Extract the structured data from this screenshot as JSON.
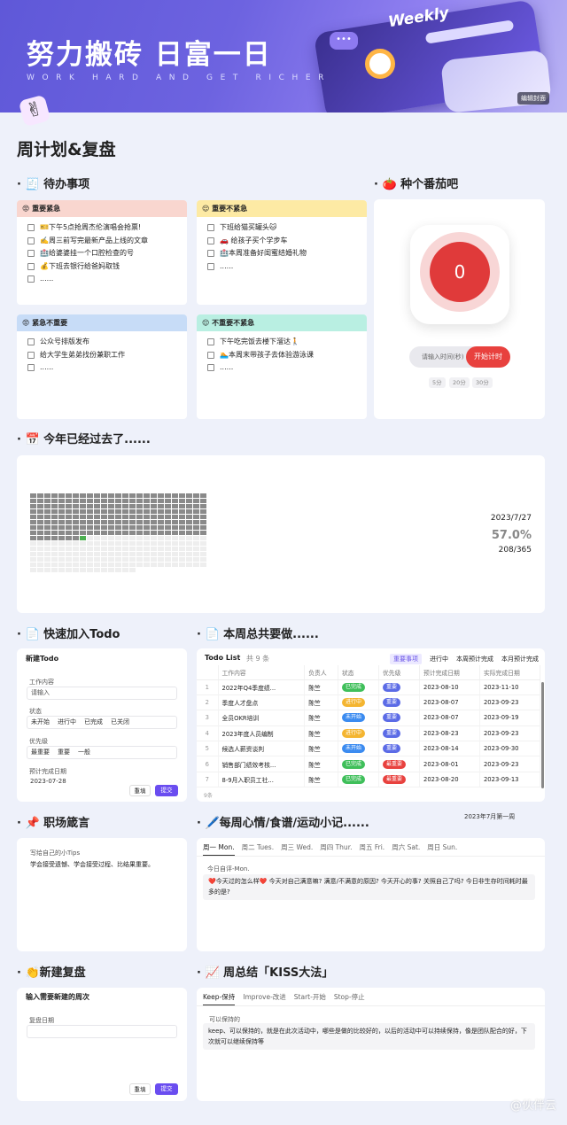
{
  "banner": {
    "title": "努力搬砖 日富一日",
    "subtitle": "WORK HARD AND GET RICHER",
    "weekly": "Weekly",
    "cover_button": "编辑封面"
  },
  "page_title": "周计划&复盘",
  "todo": {
    "heading": "· 🧾 待办事项",
    "quadrants": [
      {
        "title": "😡 重要紧急",
        "color": "#f9d6cf",
        "items": [
          "🎫下午5点抢周杰伦演唱会抢票!",
          "✍️周三前写完最新产品上线的文章",
          "🏥给婆婆挂一个口腔检查的号",
          "💰下班去银行给爸妈取钱",
          "......"
        ]
      },
      {
        "title": "😌 重要不紧急",
        "color": "#fdeaa4",
        "items": [
          "下班给猫买罐头🐱",
          "🚗 给孩子买个学步车",
          "🏥本周准备好闺蜜结婚礼物",
          "......"
        ]
      },
      {
        "title": "😡 紧急不重要",
        "color": "#c7dcf7",
        "items": [
          "公众号排版发布",
          "给大学生弟弟找份兼职工作",
          "......"
        ]
      },
      {
        "title": "😌 不重要不紧急",
        "color": "#b9efe2",
        "items": [
          "下午吃完饭去楼下溜达🚶",
          "🏊本周末带孩子去体验游泳课",
          "......"
        ]
      }
    ]
  },
  "pomodoro": {
    "heading": "· 🍅 种个番茄吧",
    "count": "0",
    "input_placeholder": "请输入时间(秒)",
    "start_label": "开始计时",
    "presets": [
      "5分",
      "20分",
      "30分"
    ]
  },
  "year_progress": {
    "heading": "· 📅 今年已经过去了......",
    "date": "2023/7/27",
    "percent": "57.0%",
    "days": "208/365",
    "elapsed_days": 208,
    "total_days": 365
  },
  "quick_todo": {
    "heading": "· 📄 快速加入Todo",
    "form_title": "新建Todo",
    "content_label": "工作内容",
    "content_placeholder": "请输入",
    "status_label": "状态",
    "status_options": [
      "未开始",
      "进行中",
      "已完成",
      "已关闭"
    ],
    "priority_label": "优先级",
    "priority_options": [
      "最重要",
      "重要",
      "一般"
    ],
    "due_label": "预计完成日期",
    "due_value": "2023-07-28",
    "reset_label": "重填",
    "submit_label": "提交"
  },
  "weekly_todo": {
    "heading": "· 📄 本周总共要做......",
    "list_title": "Todo List",
    "count_text": "共 9 条",
    "filters": [
      "重要事项",
      "进行中",
      "本周预计完成",
      "本月预计完成"
    ],
    "columns": [
      "",
      "工作内容",
      "负责人",
      "状态",
      "优先级",
      "预计完成日期",
      "实际完成日期"
    ],
    "rows": [
      {
        "idx": "1",
        "task": "2022年Q4季度绩...",
        "owner": "陈竺",
        "status": "已完成",
        "status_color": "#3fbf5a",
        "priority": "重要",
        "priority_color": "#5b6be6",
        "plan": "2023-08-10",
        "actual": "2023-11-10"
      },
      {
        "idx": "2",
        "task": "季度人才盘点",
        "owner": "陈竺",
        "status": "进行中",
        "status_color": "#f4b531",
        "priority": "重要",
        "priority_color": "#5b6be6",
        "plan": "2023-08-07",
        "actual": "2023-09-23"
      },
      {
        "idx": "3",
        "task": "全员OKR培训",
        "owner": "陈竺",
        "status": "未开始",
        "status_color": "#3b8bf0",
        "priority": "重要",
        "priority_color": "#5b6be6",
        "plan": "2023-08-07",
        "actual": "2023-09-19"
      },
      {
        "idx": "4",
        "task": "2023年度人员编制",
        "owner": "陈竺",
        "status": "进行中",
        "status_color": "#f4b531",
        "priority": "重要",
        "priority_color": "#5b6be6",
        "plan": "2023-08-23",
        "actual": "2023-09-23"
      },
      {
        "idx": "5",
        "task": "候选人薪资谈判",
        "owner": "陈竺",
        "status": "未开始",
        "status_color": "#3b8bf0",
        "priority": "重要",
        "priority_color": "#5b6be6",
        "plan": "2023-08-14",
        "actual": "2023-09-30"
      },
      {
        "idx": "6",
        "task": "销售部门绩效考核...",
        "owner": "陈竺",
        "status": "已完成",
        "status_color": "#3fbf5a",
        "priority": "最重要",
        "priority_color": "#e8413e",
        "plan": "2023-08-01",
        "actual": "2023-09-23"
      },
      {
        "idx": "7",
        "task": "8-9月入职员工社...",
        "owner": "陈竺",
        "status": "已完成",
        "status_color": "#3fbf5a",
        "priority": "最重要",
        "priority_color": "#e8413e",
        "plan": "2023-08-20",
        "actual": "2023-09-13"
      }
    ],
    "footer": "9条"
  },
  "motto": {
    "heading": "· 📌 职场箴言",
    "label": "写给自己的小Tips",
    "text": "学会接受遗憾、学会接受过程、比结果重要。"
  },
  "mood": {
    "heading": "· 🖊️每周心情/食谱/运动小记......",
    "week_note": "2023年7月第一周",
    "tabs": [
      "周一 Mon.",
      "周二 Tues.",
      "周三 Wed.",
      "周四 Thur.",
      "周五 Fri.",
      "周六 Sat.",
      "周日 Sun."
    ],
    "label": "今日自评-Mon.",
    "text": "❤️今天过的怎么样❤️ 今天对自己满意嘛? 满意/不满意的原因? 今天开心的事? 关照自己了吗? 今日非生存时间耗时最多的是?"
  },
  "new_review": {
    "heading": "· 👏新建复盘",
    "form_title": "输入需要新建的周次",
    "date_label": "复盘日期",
    "reset_label": "重填",
    "submit_label": "提交"
  },
  "kiss": {
    "heading": "· 📈 周总结「KISS大法」",
    "tabs": [
      "Keep-保持",
      "Improve-改进",
      "Start-开始",
      "Stop-停止"
    ],
    "label": "可以保持的",
    "text": "keep、可以保持的，就是在此次活动中，哪些是做的比较好的，以后的活动中可以持续保持，像是团队配合的好，下次就可以继续保持等"
  },
  "watermark": "@伙伴云"
}
